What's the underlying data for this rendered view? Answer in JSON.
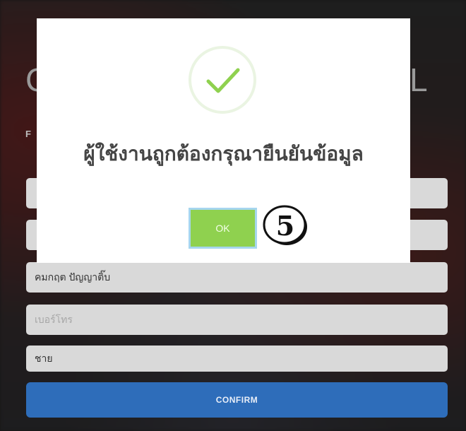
{
  "background": {
    "heading_left": "C",
    "heading_right": "L",
    "subheading": "F"
  },
  "form": {
    "fields": [
      {
        "value": "",
        "placeholder": ""
      },
      {
        "value": "",
        "placeholder": ""
      },
      {
        "value": "คมกฤต ปัญญาติ๊บ",
        "placeholder": ""
      },
      {
        "value": "",
        "placeholder": "เบอร์โทร"
      },
      {
        "value": "ชาย",
        "placeholder": ""
      }
    ],
    "confirm_label": "CONFIRM"
  },
  "modal": {
    "icon": "check-icon",
    "message": "ผู้ใช้งานถูกต้องกรุณายืนยันข้อมูล",
    "ok_label": "OK"
  },
  "annotation": {
    "step_number": "5"
  },
  "colors": {
    "ok_button": "#8fd14f",
    "check": "#8fd14f",
    "confirm_button": "#2e6dba"
  }
}
